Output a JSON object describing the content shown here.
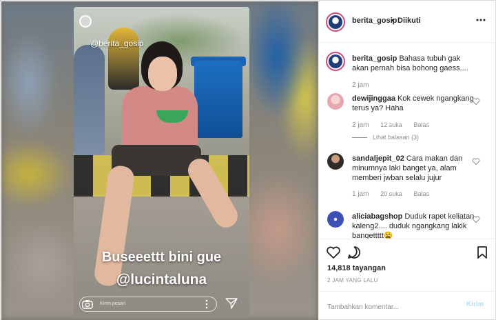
{
  "story": {
    "watermark": "@berita_gosip",
    "caption_line1": "Buseeettt bini gue",
    "caption_line2": "@lucintaluna",
    "reply_placeholder": "Kirim pesan"
  },
  "header": {
    "username": "berita_gosip",
    "separator": "•",
    "follow_status": "Diikuti",
    "more_icon": "more-horizontal-icon"
  },
  "comments": [
    {
      "username": "berita_gosip",
      "text": "Bahasa tubuh gak akan pernah bisa bohong gaess....",
      "time": "2 jam",
      "is_caption": true
    },
    {
      "username": "dewijinggaa",
      "text": "Kok cewek ngangkang terus ya? Haha",
      "time": "2 jam",
      "likes": "12 suka",
      "reply_label": "Balas",
      "view_replies": "Lihat balasan (3)"
    },
    {
      "username": "sandaljepit_02",
      "text": "Cara makan dan minumnya laki banget ya, alam memberi jwban selalu jujur",
      "time": "1 jam",
      "likes": "20 suka",
      "reply_label": "Balas"
    },
    {
      "username": "aliciabagshop",
      "text": "Duduk rapet keliatan kaleng2.... duduk ngangkang lakik bangettttt😩",
      "time": "",
      "likes": "",
      "reply_label": ""
    }
  ],
  "actions": {
    "views": "14,818 tayangan",
    "time_ago": "2 JAM YANG LALU",
    "comment_placeholder": "Tambahkan komentar...",
    "post_label": "Kirim"
  },
  "colors": {
    "accent_link": "#b2dffc",
    "muted_text": "#8e8e8e",
    "border": "#dbdbdb",
    "avatar_ring": "#c94b7b"
  }
}
